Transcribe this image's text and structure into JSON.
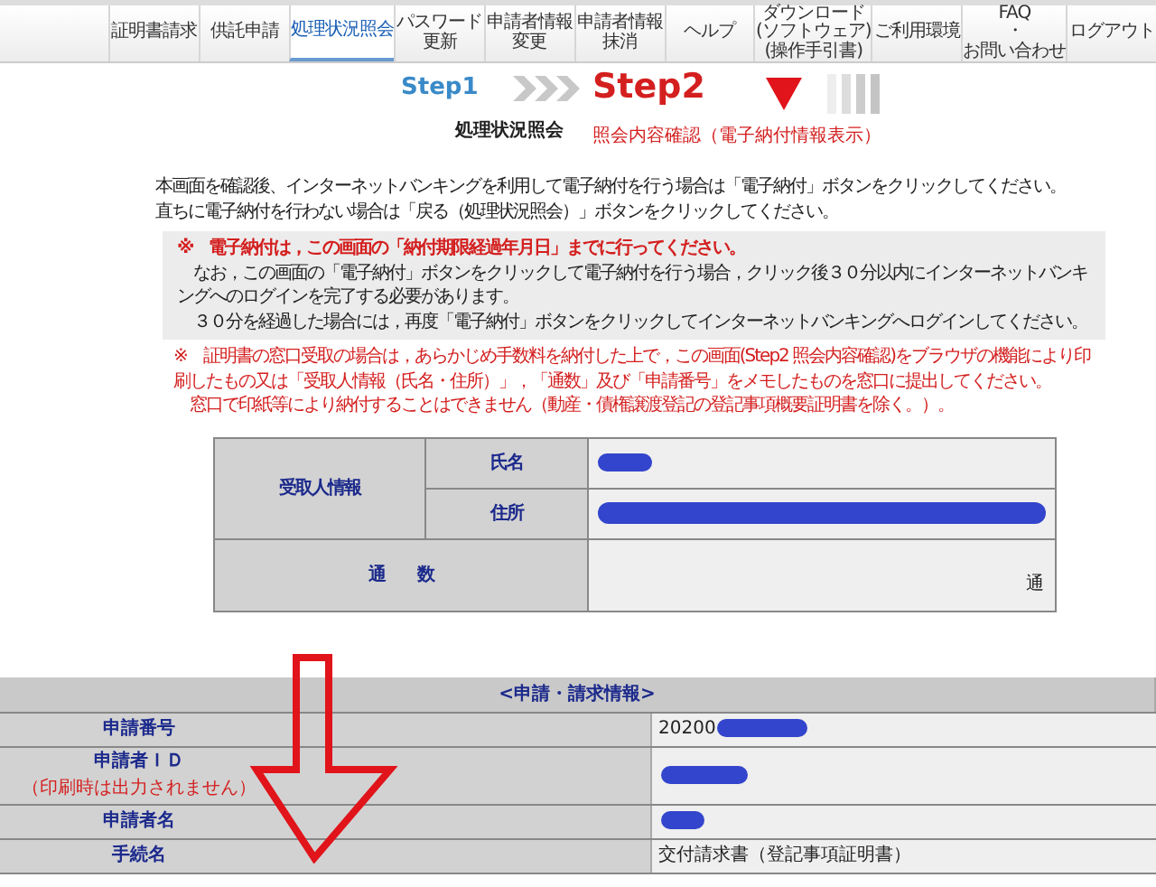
{
  "nav": [
    {
      "lines": [
        "証明書請求"
      ],
      "selected": false
    },
    {
      "lines": [
        "供託申請"
      ],
      "selected": false
    },
    {
      "lines": [
        "処理状況照会"
      ],
      "selected": true
    },
    {
      "lines": [
        "パスワード",
        "更新"
      ],
      "selected": false
    },
    {
      "lines": [
        "申請者情報",
        "変更"
      ],
      "selected": false
    },
    {
      "lines": [
        "申請者情報",
        "抹消"
      ],
      "selected": false
    },
    {
      "lines": [
        "ヘルプ"
      ],
      "selected": false
    },
    {
      "lines": [
        "ダウンロード",
        "(ソフトウェア)",
        "(操作手引書)"
      ],
      "selected": false
    },
    {
      "lines": [
        "ご利用環境"
      ],
      "selected": false
    },
    {
      "lines": [
        "FAQ",
        "・",
        "お問い合わせ"
      ],
      "selected": false
    },
    {
      "lines": [
        "ログアウト"
      ],
      "selected": false
    }
  ],
  "steps": [
    {
      "label": "Step1",
      "caption": "処理状況照会",
      "current": false
    },
    {
      "label": "Step2",
      "caption": "照会内容確認（電子納付情報表示）",
      "current": true
    }
  ],
  "intro": [
    "本画面を確認後、インターネットバンキングを利用して電子納付を行う場合は「電子納付」ボタンをクリックしてください。",
    "直ちに電子納付を行わない場合は「戻る（処理状況照会）」ボタンをクリックしてください。"
  ],
  "notice": {
    "mark": "※",
    "headline": "電子納付は，この画面の「納付期限経過年月日」までに行ってください。",
    "paragraphs": [
      "　なお，この画面の「電子納付」ボタンをクリックして電子納付を行う場合，クリック後３０分以内にインターネットバンキングへのログインを完了する必要があります。",
      "　３０分を経過した場合には，再度「電子納付」ボタンをクリックしてインターネットバンキングへログインしてください。"
    ]
  },
  "note": {
    "mark": "※",
    "lines": [
      "証明書の窓口受取の場合は，あらかじめ手数料を納付した上で，この画面(Step2 照会内容確認)をブラウザの機能により印刷したもの又は「受取人情報（氏名・住所）」，「通数」及び「申請番号」をメモしたものを窓口に提出してください。",
      "窓口で印紙等により納付することはできません（動産・債権譲渡登記の登記事項概要証明書を除く。）。"
    ]
  },
  "recipient": {
    "group": "受取人情報",
    "rows": [
      {
        "label": "氏名",
        "redacted": true
      },
      {
        "label": "住所",
        "redacted": true
      }
    ],
    "count_label": "通　　数",
    "count_unit": "通"
  },
  "request": {
    "title": "<申請・請求情報>",
    "rows": [
      {
        "label": "申請番号",
        "value": "20200",
        "redacted": true
      },
      {
        "label": "申請者ＩＤ",
        "sublabel": "（印刷時は出力されません）",
        "redacted": true
      },
      {
        "label": "申請者名",
        "redacted": true
      },
      {
        "label": "手続名",
        "value": "交付請求書（登記事項証明書）",
        "redacted": false
      }
    ]
  }
}
